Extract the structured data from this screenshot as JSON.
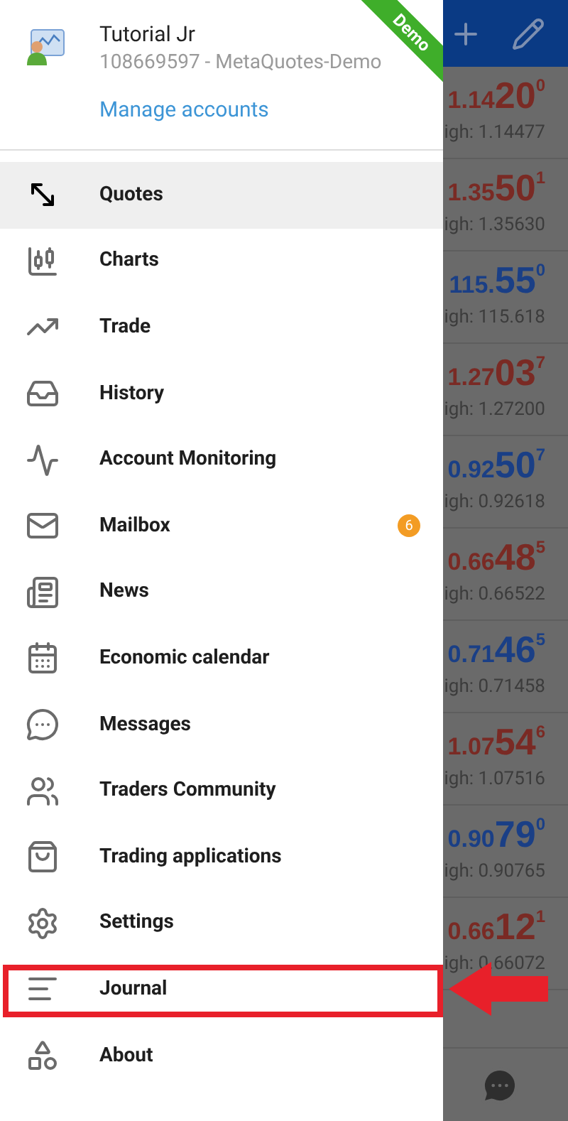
{
  "quotes": [
    {
      "price_head": "1.14",
      "price_big": "20",
      "price_tail": "0",
      "high": "igh: 1.14477",
      "color": "#7a2a24"
    },
    {
      "price_head": "1.35",
      "price_big": "50",
      "price_tail": "1",
      "high": "igh: 1.35630",
      "color": "#7a2a24"
    },
    {
      "price_head": "115.",
      "price_big": "55",
      "price_tail": "0",
      "high": "igh: 115.618",
      "color": "#1a3f86"
    },
    {
      "price_head": "1.27",
      "price_big": "03",
      "price_tail": "7",
      "high": "igh: 1.27200",
      "color": "#7a2a24"
    },
    {
      "price_head": "0.92",
      "price_big": "50",
      "price_tail": "7",
      "high": "igh: 0.92618",
      "color": "#1a3f86"
    },
    {
      "price_head": "0.66",
      "price_big": "48",
      "price_tail": "5",
      "high": "igh: 0.66522",
      "color": "#7a2a24"
    },
    {
      "price_head": "0.71",
      "price_big": "46",
      "price_tail": "5",
      "high": "igh: 0.71458",
      "color": "#1a3f86"
    },
    {
      "price_head": "1.07",
      "price_big": "54",
      "price_tail": "6",
      "high": "igh: 1.07516",
      "color": "#7a2a24"
    },
    {
      "price_head": "0.90",
      "price_big": "79",
      "price_tail": "0",
      "high": "igh: 0.90765",
      "color": "#1a3f86"
    },
    {
      "price_head": "0.66",
      "price_big": "12",
      "price_tail": "1",
      "high": "igh: 0.66072",
      "color": "#7a2a24"
    }
  ],
  "drawer": {
    "account": {
      "name": "Tutorial Jr",
      "server": "108669597 - MetaQuotes-Demo",
      "manage_link": "Manage accounts",
      "ribbon": "Demo"
    },
    "items": [
      {
        "label": "Quotes",
        "selected": true,
        "highlighted": false
      },
      {
        "label": "Charts",
        "selected": false,
        "highlighted": false
      },
      {
        "label": "Trade",
        "selected": false,
        "highlighted": false
      },
      {
        "label": "History",
        "selected": false,
        "highlighted": false
      },
      {
        "label": "Account Monitoring",
        "selected": false,
        "highlighted": false
      },
      {
        "label": "Mailbox",
        "selected": false,
        "highlighted": false,
        "badge": "6"
      },
      {
        "label": "News",
        "selected": false,
        "highlighted": false
      },
      {
        "label": "Economic calendar",
        "selected": false,
        "highlighted": false
      },
      {
        "label": "Messages",
        "selected": false,
        "highlighted": false
      },
      {
        "label": "Traders Community",
        "selected": false,
        "highlighted": false
      },
      {
        "label": "Trading applications",
        "selected": false,
        "highlighted": false
      },
      {
        "label": "Settings",
        "selected": false,
        "highlighted": false
      },
      {
        "label": "Journal",
        "selected": false,
        "highlighted": true
      },
      {
        "label": "About",
        "selected": false,
        "highlighted": false
      }
    ]
  }
}
